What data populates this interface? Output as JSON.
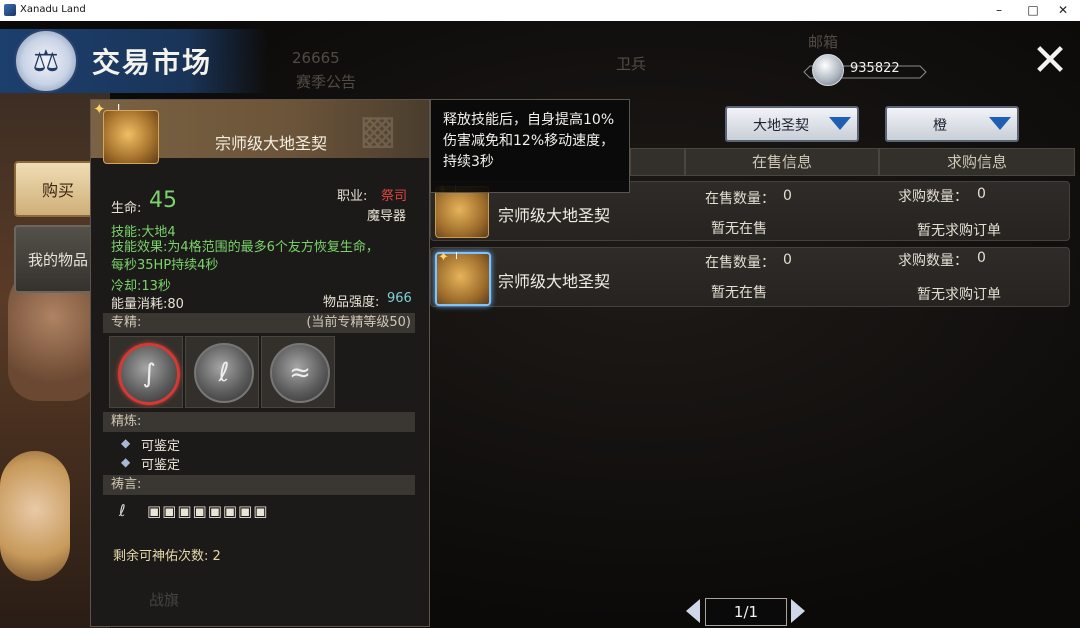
{
  "window": {
    "title": "Xanadu Land",
    "controls": [
      "minimize-icon",
      "maximize-icon",
      "close-icon"
    ]
  },
  "header": {
    "title": "交易市场",
    "emblem_icon": "scales-icon",
    "bg_number": "26665",
    "bg_notice": "赛季公告",
    "bg_mailbox": "邮箱",
    "bg_guard": "卫兵"
  },
  "currency": {
    "icon": "silver-coin-icon",
    "amount": "935822"
  },
  "close_button": {
    "icon": "close-x-icon"
  },
  "tabs": [
    {
      "label": "购买",
      "active": true
    },
    {
      "label": "我的物品",
      "active": false
    }
  ],
  "filters": [
    {
      "selected": "大地圣契",
      "icon": "chevron-down-icon"
    },
    {
      "selected": "橙",
      "icon": "chevron-down-icon"
    }
  ],
  "table": {
    "headers": [
      "在售信息",
      "求购信息"
    ],
    "rows": [
      {
        "name": "宗师级大地圣契",
        "tier": "I",
        "sale_count_label": "在售数量：",
        "sale_count": "0",
        "sale_status": "暂无在售",
        "buy_count_label": "求购数量：",
        "buy_count": "0",
        "buy_status": "暂无求购订单"
      },
      {
        "name": "宗师级大地圣契",
        "tier": "I",
        "sale_count_label": "在售数量：",
        "sale_count": "0",
        "sale_status": "暂无在售",
        "buy_count_label": "求购数量：",
        "buy_count": "0",
        "buy_status": "暂无求购订单"
      }
    ]
  },
  "pager": {
    "label": "1/1"
  },
  "tooltip": {
    "tier": "I",
    "name": "宗师级大地圣契",
    "hp_label": "生命:",
    "hp_value": "45",
    "class_label": "职业:",
    "class_value": "祭司",
    "slot_type": "魔导器",
    "skill": "技能:大地4",
    "effect": "技能效果:为4格范围的最多6个友方恢复生命，每秒35HP持续4秒",
    "cooldown": "冷却:13秒",
    "energy": "能量消耗:80",
    "strength_label": "物品强度:",
    "strength_value": "966",
    "spec_label": "专精:",
    "spec_level": "(当前专精等级50)",
    "spec_icons": [
      "spec-rune-1-icon",
      "spec-rune-2-icon",
      "spec-rune-3-icon"
    ],
    "refine_label": "精炼:",
    "refine_items": [
      "可鉴定",
      "可鉴定"
    ],
    "prayer_label": "祷言:",
    "blessing": "剩余可神佑次数: 2",
    "bg_text": "战旗"
  },
  "skill_desc": {
    "text": "释放技能后，自身提高10%伤害减免和12%移动速度，持续3秒"
  },
  "colors": {
    "header_blue": "#1c3f6e",
    "green_text": "#7bd46a",
    "class_red": "#e0463d",
    "strength_teal": "#7fd0d6",
    "accent_blue": "#1e5fb3"
  }
}
